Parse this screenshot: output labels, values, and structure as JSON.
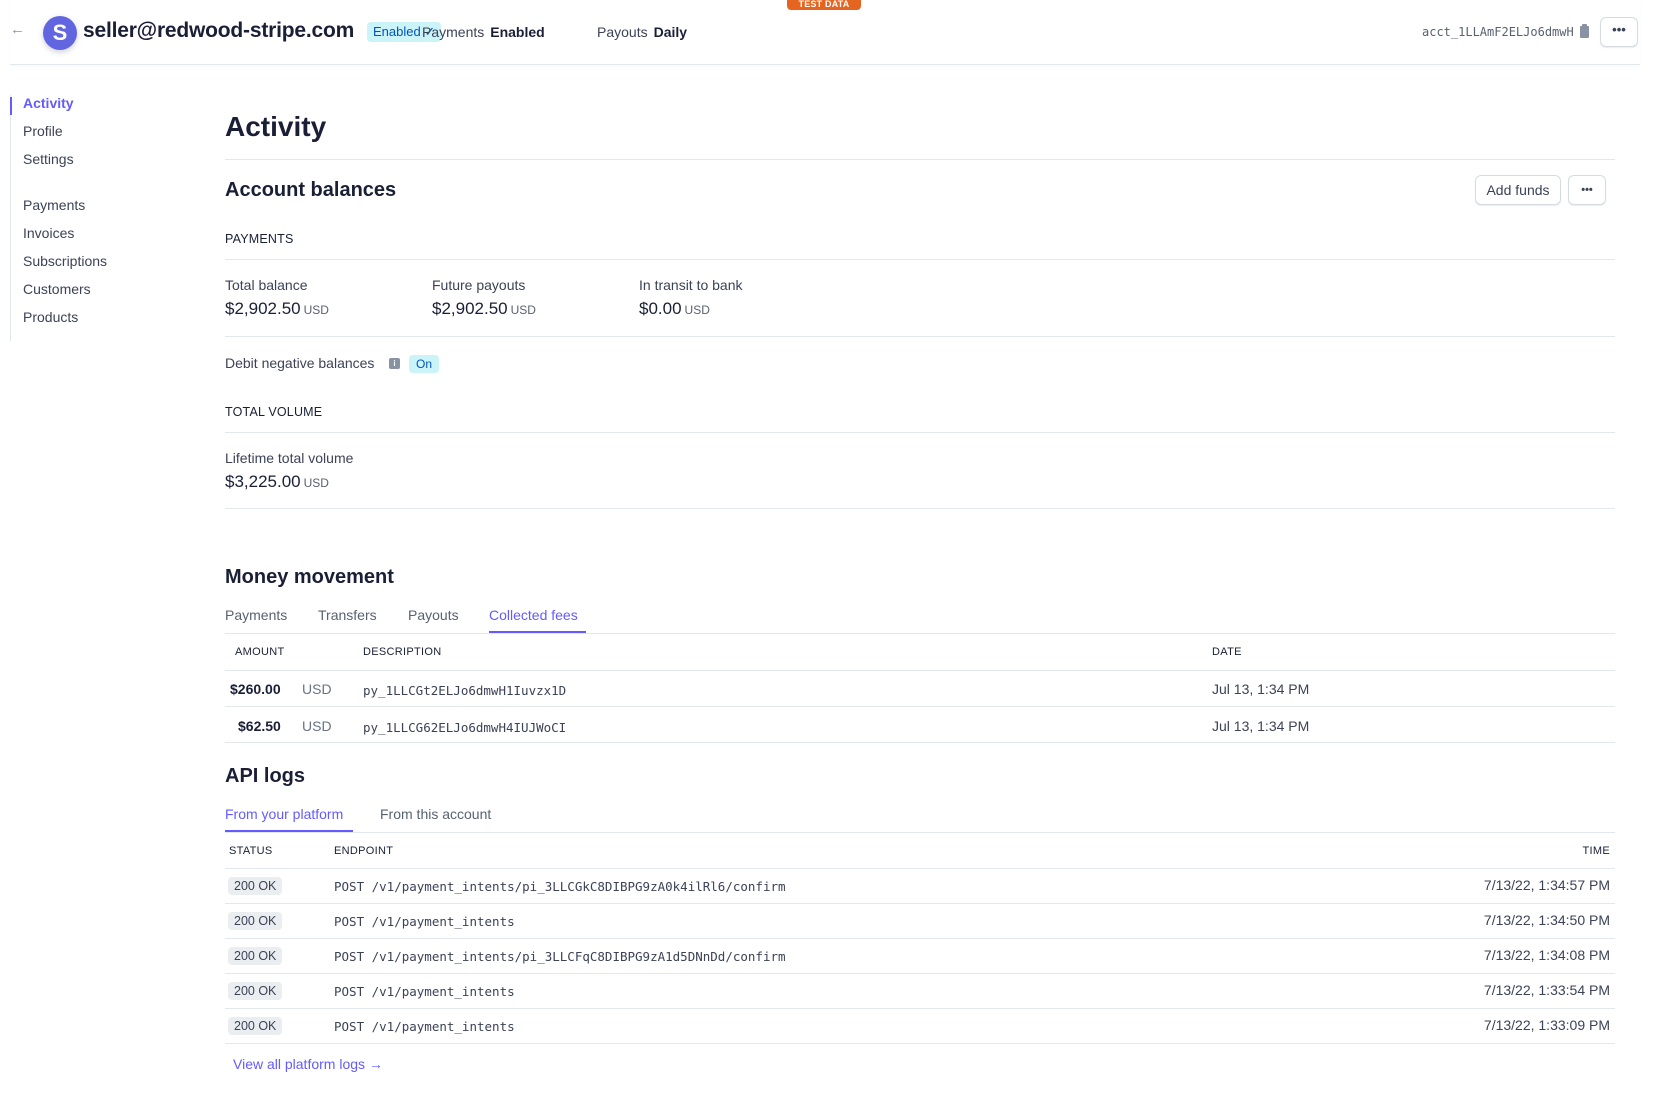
{
  "banner": {
    "test_data": "TEST DATA"
  },
  "header": {
    "back_icon": "arrow-left-icon",
    "avatar_letter": "S",
    "account_email": "seller@redwood-stripe.com",
    "status_badge": "Enabled",
    "status_check": "✓",
    "payments_label": "Payments",
    "payments_value": "Enabled",
    "payouts_label": "Payouts",
    "payouts_value": "Daily",
    "account_id": "acct_1LLAmF2ELJo6dmwH",
    "copy_icon": "clipboard-icon",
    "more_label": "•••"
  },
  "sidebar": {
    "items": [
      {
        "label": "Activity",
        "active": true
      },
      {
        "label": "Profile"
      },
      {
        "label": "Settings"
      },
      {
        "label": "Payments"
      },
      {
        "label": "Invoices"
      },
      {
        "label": "Subscriptions"
      },
      {
        "label": "Customers"
      },
      {
        "label": "Products"
      }
    ]
  },
  "main": {
    "title": "Activity",
    "account_balances": {
      "title": "Account balances",
      "add_funds_label": "Add funds",
      "more_label": "•••",
      "payments_heading": "PAYMENTS",
      "stats": [
        {
          "label": "Total balance",
          "value": "$2,902.50",
          "currency": "USD"
        },
        {
          "label": "Future payouts",
          "value": "$2,902.50",
          "currency": "USD"
        },
        {
          "label": "In transit to bank",
          "value": "$0.00",
          "currency": "USD"
        }
      ],
      "debit_label": "Debit negative balances",
      "debit_info_icon": "i",
      "debit_status": "On",
      "volume_heading": "TOTAL VOLUME",
      "lifetime_label": "Lifetime total volume",
      "lifetime_value": "$3,225.00",
      "lifetime_currency": "USD"
    },
    "money_movement": {
      "title": "Money movement",
      "tabs": [
        {
          "label": "Payments"
        },
        {
          "label": "Transfers"
        },
        {
          "label": "Payouts"
        },
        {
          "label": "Collected fees",
          "active": true
        }
      ],
      "columns": {
        "amount": "AMOUNT",
        "description": "DESCRIPTION",
        "date": "DATE"
      },
      "rows": [
        {
          "amount": "$260.00",
          "currency": "USD",
          "description": "py_1LLCGt2ELJo6dmwH1Iuvzx1D",
          "date": "Jul 13, 1:34 PM"
        },
        {
          "amount": "$62.50",
          "currency": "USD",
          "description": "py_1LLCG62ELJo6dmwH4IUJWoCI",
          "date": "Jul 13, 1:34 PM"
        }
      ]
    },
    "api_logs": {
      "title": "API logs",
      "tabs": [
        {
          "label": "From your platform",
          "active": true
        },
        {
          "label": "From this account"
        }
      ],
      "columns": {
        "status": "STATUS",
        "endpoint": "ENDPOINT",
        "time": "TIME"
      },
      "rows": [
        {
          "status": "200 OK",
          "endpoint": "POST /v1/payment_intents/pi_3LLCGkC8DIBPG9zA0k4ilRl6/confirm",
          "time": "7/13/22, 1:34:57 PM"
        },
        {
          "status": "200 OK",
          "endpoint": "POST /v1/payment_intents",
          "time": "7/13/22, 1:34:50 PM"
        },
        {
          "status": "200 OK",
          "endpoint": "POST /v1/payment_intents/pi_3LLCFqC8DIBPG9zA1d5DNnDd/confirm",
          "time": "7/13/22, 1:34:08 PM"
        },
        {
          "status": "200 OK",
          "endpoint": "POST /v1/payment_intents",
          "time": "7/13/22, 1:33:54 PM"
        },
        {
          "status": "200 OK",
          "endpoint": "POST /v1/payment_intents",
          "time": "7/13/22, 1:33:09 PM"
        }
      ],
      "view_all_label": "View all platform logs →"
    }
  },
  "colors": {
    "accent": "#635bff",
    "test_banner": "#e5641f",
    "badge_bg": "#cbf4f9",
    "badge_text": "#0055bc"
  }
}
